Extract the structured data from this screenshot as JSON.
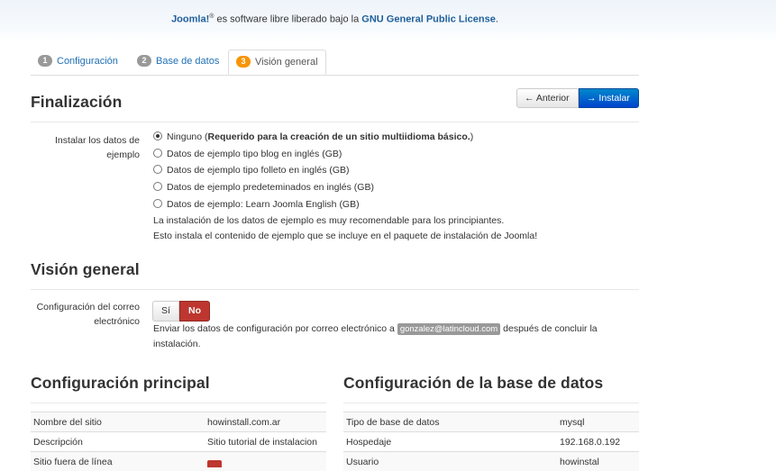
{
  "license": {
    "brand": "Joomla!",
    "reg": "®",
    "text": " es software libre liberado bajo la ",
    "link": "GNU General Public License",
    "period": "."
  },
  "tabs": [
    {
      "num": "1",
      "label": "Configuración",
      "active": false
    },
    {
      "num": "2",
      "label": "Base de datos",
      "active": false
    },
    {
      "num": "3",
      "label": "Visión general",
      "active": true
    }
  ],
  "finalizacion": {
    "title": "Finalización",
    "prev_button": "Anterior",
    "install_button": "Instalar",
    "sample_label": "Instalar los datos de ejemplo",
    "options": [
      {
        "text": "Ninguno (",
        "bold": "Requerido para la creación de un sitio multiidioma básico.",
        "after": ")",
        "checked": true
      },
      {
        "text": "Datos de ejemplo tipo blog en inglés (GB)",
        "checked": false
      },
      {
        "text": "Datos de ejemplo tipo folleto en inglés (GB)",
        "checked": false
      },
      {
        "text": "Datos de ejemplo predeteminados en inglés (GB)",
        "checked": false
      },
      {
        "text": "Datos de ejemplo: Learn Joomla English (GB)",
        "checked": false
      }
    ],
    "help_line1": "La instalación de los datos de ejemplo es muy recomendable para los principiantes.",
    "help_line2": "Esto instala el contenido de ejemplo que se incluye en el paquete de instalación de Joomla!"
  },
  "overview": {
    "title": "Visión general",
    "email_label": "Configuración del correo electrónico",
    "yes": "Sí",
    "no": "No",
    "email_help_before": "Enviar los datos de configuración por correo electrónico a ",
    "email": "gonzalez@latincloud.com",
    "email_help_after": " después de concluir la instalación."
  },
  "main_config": {
    "title": "Configuración principal",
    "rows": [
      {
        "key": "Nombre del sitio",
        "value": "howinstall.com.ar"
      },
      {
        "key": "Descripción",
        "value": "Sitio tutorial de instalacion"
      },
      {
        "key": "Sitio fuera de línea",
        "value": ""
      }
    ]
  },
  "db_config": {
    "title": "Configuración de la base de datos",
    "rows": [
      {
        "key": "Tipo de base de datos",
        "value": "mysql"
      },
      {
        "key": "Hospedaje",
        "value": "192.168.0.192"
      },
      {
        "key": "Usuario",
        "value": "howinstal"
      }
    ]
  },
  "colors": {
    "primary": "#0074cc",
    "danger": "#bd362f",
    "active_tab_badge": "#f89406",
    "link": "#1f6fb4"
  }
}
